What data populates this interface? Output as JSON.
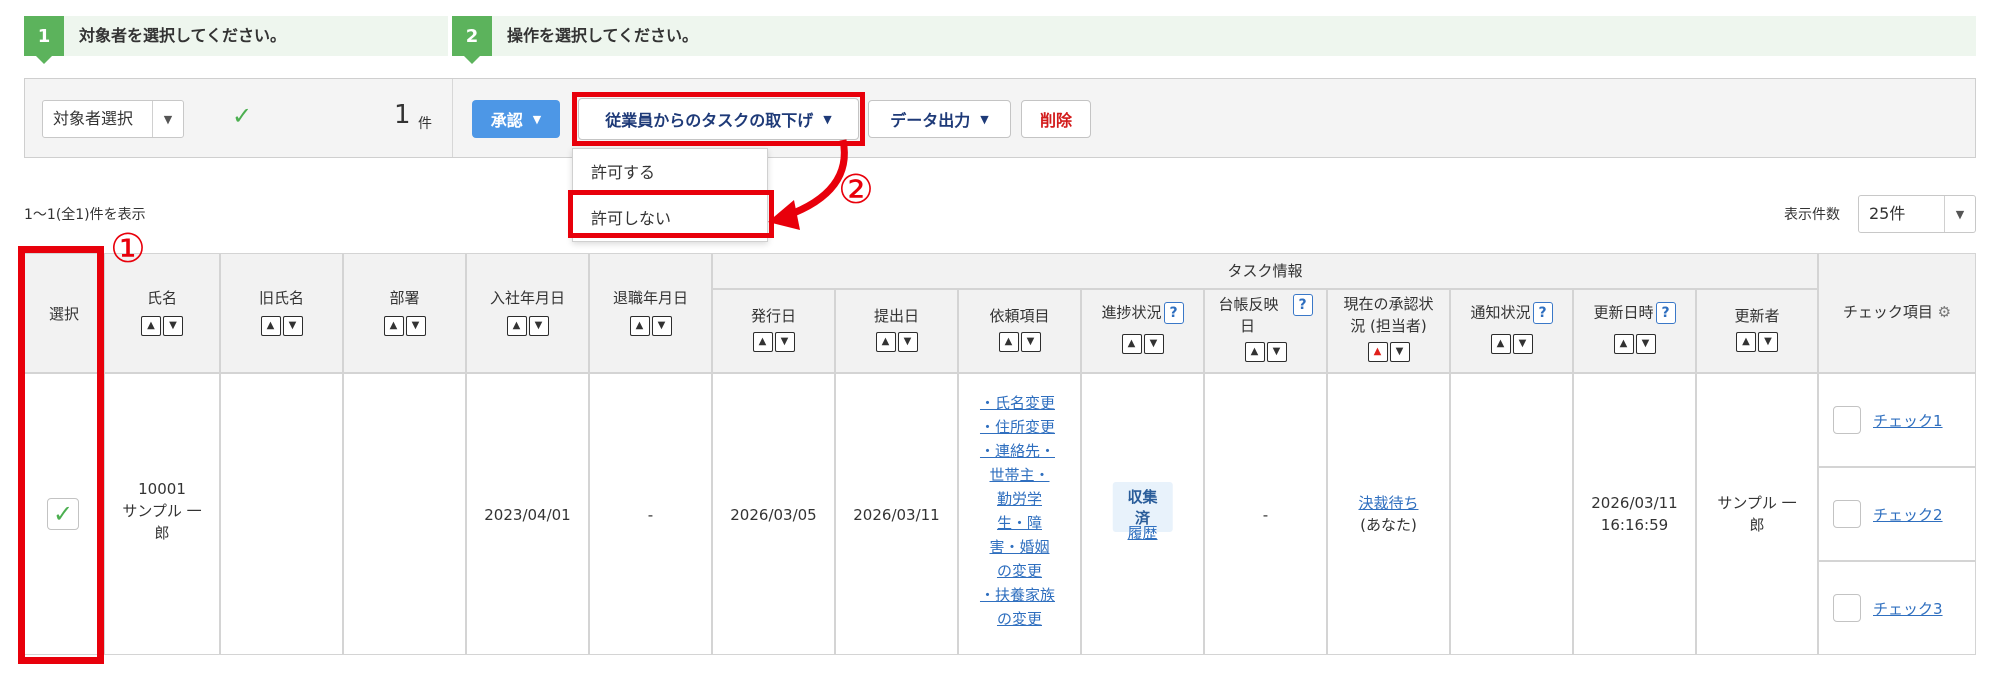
{
  "steps": [
    {
      "num": "1",
      "text": "対象者を選択してください。"
    },
    {
      "num": "2",
      "text": "操作を選択してください。"
    }
  ],
  "toolbar": {
    "target_select": "対象者選択",
    "count": "1",
    "count_unit": "件",
    "approve_label": "承認",
    "withdraw_label": "従業員からのタスクの取下げ",
    "export_label": "データ出力",
    "delete_label": "削除"
  },
  "menu": {
    "allow": "許可する",
    "deny": "許可しない"
  },
  "annotations": {
    "one": "①",
    "two": "②"
  },
  "list": {
    "showing": "1～1(全1)件を表示",
    "per_page_label": "表示件数",
    "per_page_value": "25件"
  },
  "table": {
    "headers": {
      "select": "選択",
      "name": "氏名",
      "old_name": "旧氏名",
      "dept": "部署",
      "join": "入社年月日",
      "leave": "退職年月日",
      "task_group": "タスク情報",
      "issue": "発行日",
      "submit": "提出日",
      "request_items": "依頼項目",
      "progress": "進捗状況",
      "ledger_1": "台帳反映",
      "ledger_2": "日",
      "approval_1": "現在の承認状",
      "approval_2": "況 (担当者)",
      "notice": "通知状況",
      "updated": "更新日時",
      "updater": "更新者",
      "check_items": "チェック項目"
    },
    "row": {
      "emp_no": "10001",
      "name_1": "サンプル 一",
      "name_2": "郎",
      "join": "2023/04/01",
      "leave": "-",
      "issue": "2026/03/05",
      "submit": "2026/03/11",
      "request_lines": [
        "・氏名変更",
        "・住所変更",
        "・連絡先・",
        "世帯主・",
        "勤労学",
        "生・障",
        "害・婚姻",
        "の変更",
        "・扶養家族",
        "の変更"
      ],
      "progress_badge": "収集済",
      "history": "履歴",
      "ledger": "-",
      "approval_link": "決裁待ち",
      "approval_who": "(あなた)",
      "updated_date": "2026/03/11",
      "updated_time": "16:16:59",
      "updater_1": "サンプル 一",
      "updater_2": "郎",
      "checks": [
        "チェック1",
        "チェック2",
        "チェック3"
      ]
    }
  },
  "colors": {
    "accent_green": "#5cb35c",
    "annotation_red": "#e8000b",
    "link_blue": "#2f6fbf",
    "primary_button": "#4d97e6"
  }
}
